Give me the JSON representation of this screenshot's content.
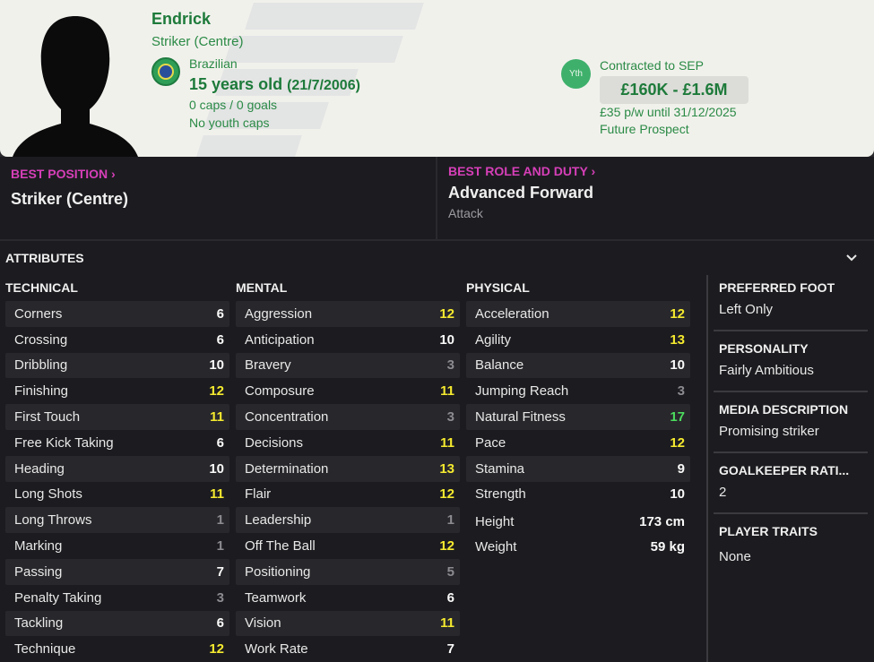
{
  "player": {
    "name": "Endrick",
    "position": "Striker (Centre)",
    "nationality": "Brazilian",
    "age": "15 years old",
    "dob": "(21/7/2006)",
    "caps": "0 caps / 0 goals",
    "youth_caps": "No youth caps"
  },
  "contract": {
    "badge": "Yth",
    "status": "Contracted to SEP",
    "value": "£160K - £1.6M",
    "wage": "£35 p/w until 31/12/2025",
    "tag": "Future Prospect"
  },
  "best_position": {
    "title": "BEST POSITION",
    "value": "Striker (Centre)"
  },
  "best_role": {
    "title": "BEST ROLE AND DUTY",
    "value": "Advanced Forward",
    "duty": "Attack"
  },
  "attributes": {
    "heading": "ATTRIBUTES",
    "technical": {
      "title": "TECHNICAL",
      "items": [
        {
          "label": "Corners",
          "value": "6"
        },
        {
          "label": "Crossing",
          "value": "6"
        },
        {
          "label": "Dribbling",
          "value": "10"
        },
        {
          "label": "Finishing",
          "value": "12"
        },
        {
          "label": "First Touch",
          "value": "11"
        },
        {
          "label": "Free Kick Taking",
          "value": "6"
        },
        {
          "label": "Heading",
          "value": "10"
        },
        {
          "label": "Long Shots",
          "value": "11"
        },
        {
          "label": "Long Throws",
          "value": "1"
        },
        {
          "label": "Marking",
          "value": "1"
        },
        {
          "label": "Passing",
          "value": "7"
        },
        {
          "label": "Penalty Taking",
          "value": "3"
        },
        {
          "label": "Tackling",
          "value": "6"
        },
        {
          "label": "Technique",
          "value": "12"
        }
      ]
    },
    "mental": {
      "title": "MENTAL",
      "items": [
        {
          "label": "Aggression",
          "value": "12"
        },
        {
          "label": "Anticipation",
          "value": "10"
        },
        {
          "label": "Bravery",
          "value": "3"
        },
        {
          "label": "Composure",
          "value": "11"
        },
        {
          "label": "Concentration",
          "value": "3"
        },
        {
          "label": "Decisions",
          "value": "11"
        },
        {
          "label": "Determination",
          "value": "13"
        },
        {
          "label": "Flair",
          "value": "12"
        },
        {
          "label": "Leadership",
          "value": "1"
        },
        {
          "label": "Off The Ball",
          "value": "12"
        },
        {
          "label": "Positioning",
          "value": "5"
        },
        {
          "label": "Teamwork",
          "value": "6"
        },
        {
          "label": "Vision",
          "value": "11"
        },
        {
          "label": "Work Rate",
          "value": "7"
        }
      ]
    },
    "physical": {
      "title": "PHYSICAL",
      "items": [
        {
          "label": "Acceleration",
          "value": "12"
        },
        {
          "label": "Agility",
          "value": "13"
        },
        {
          "label": "Balance",
          "value": "10"
        },
        {
          "label": "Jumping Reach",
          "value": "3"
        },
        {
          "label": "Natural Fitness",
          "value": "17"
        },
        {
          "label": "Pace",
          "value": "12"
        },
        {
          "label": "Stamina",
          "value": "9"
        },
        {
          "label": "Strength",
          "value": "10"
        }
      ],
      "height_label": "Height",
      "height": "173 cm",
      "weight_label": "Weight",
      "weight": "59 kg"
    }
  },
  "info": {
    "preferred_foot": {
      "title": "PREFERRED FOOT",
      "value": "Left Only"
    },
    "personality": {
      "title": "PERSONALITY",
      "value": "Fairly Ambitious"
    },
    "media": {
      "title": "MEDIA DESCRIPTION",
      "value": "Promising striker"
    },
    "gk_rating": {
      "title": "GOALKEEPER RATI...",
      "value": "2"
    },
    "traits": {
      "title": "PLAYER TRAITS",
      "value": "None"
    }
  },
  "colors": {
    "accent_pink": "#d63fb8",
    "green": "#1d7a3a",
    "yellow": "#f6ea2f",
    "bright_green": "#4cdc5e"
  }
}
